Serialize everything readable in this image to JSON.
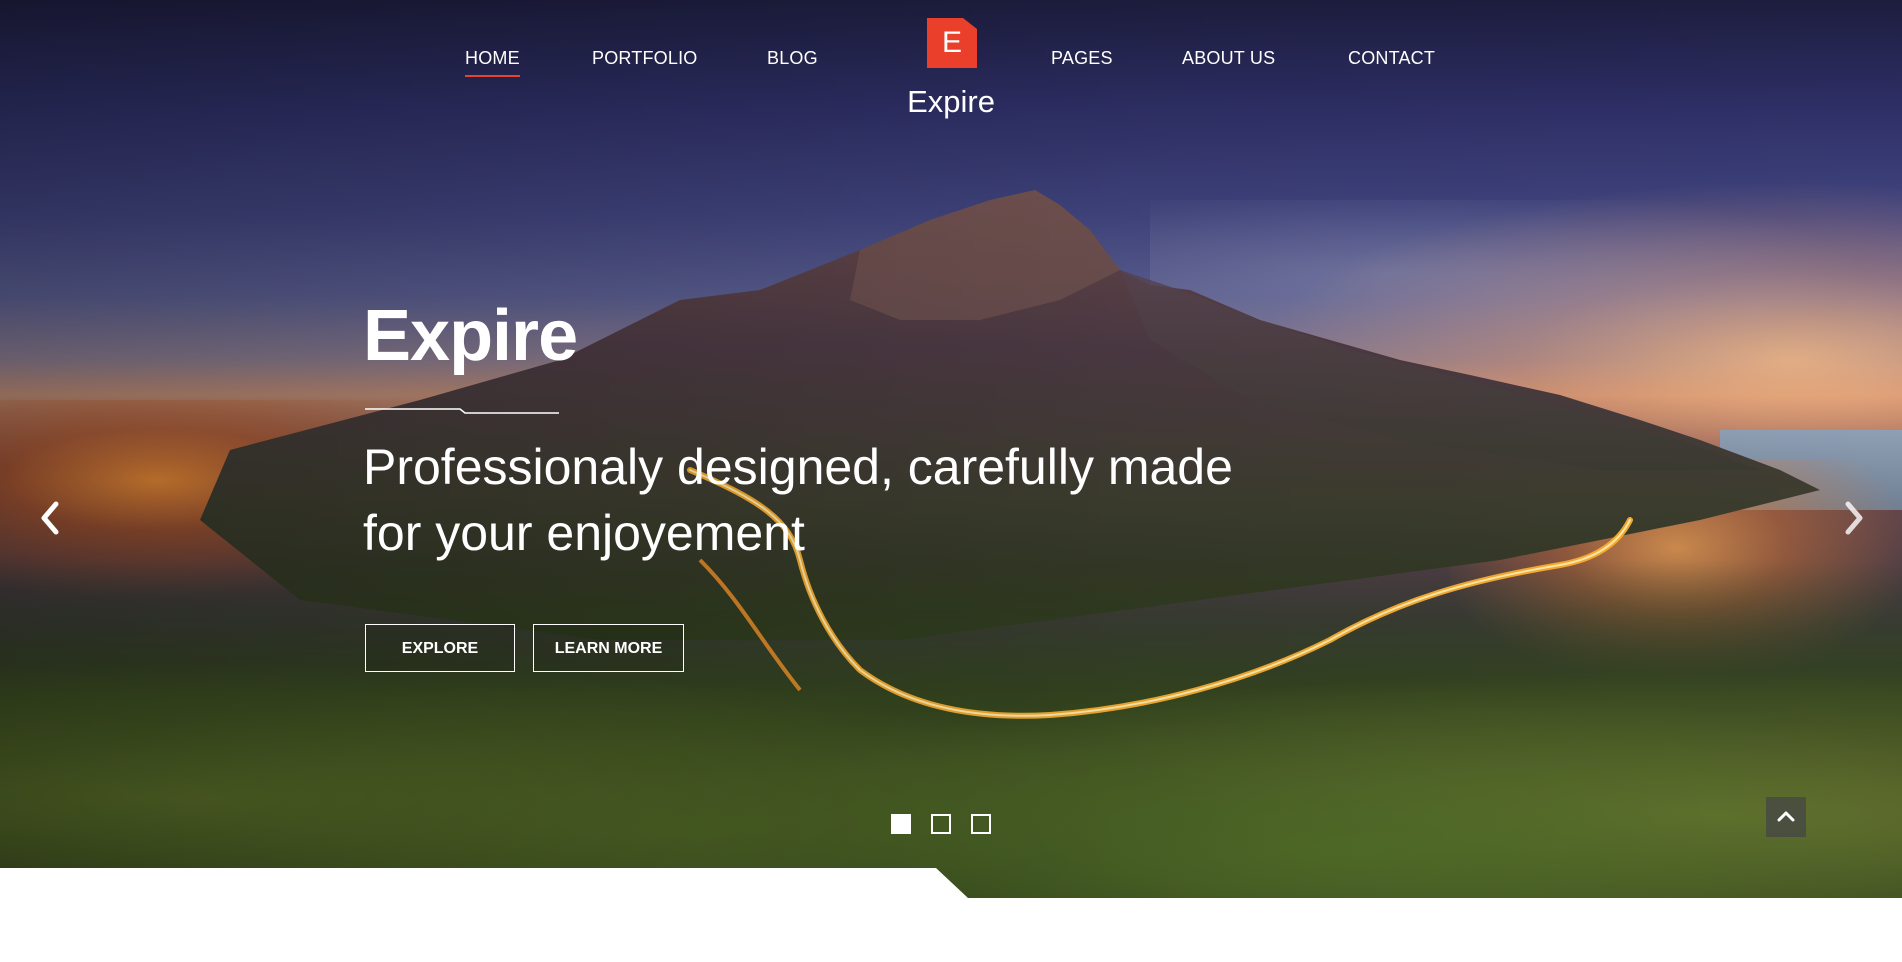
{
  "nav": {
    "items": [
      {
        "label": "HOME",
        "active": true
      },
      {
        "label": "PORTFOLIO",
        "active": false
      },
      {
        "label": "BLOG",
        "active": false
      },
      {
        "label": "PAGES",
        "active": false
      },
      {
        "label": "ABOUT US",
        "active": false
      },
      {
        "label": "CONTACT",
        "active": false
      }
    ]
  },
  "logo": {
    "letter": "E",
    "name": "Expire"
  },
  "hero": {
    "title": "Expire",
    "subtitle_line1": "Professionaly designed, carefully made",
    "subtitle_line2": "for your enjoyement",
    "buttons": {
      "explore": "EXPLORE",
      "learn_more": "LEARN MORE"
    }
  },
  "slider": {
    "slide_count": 3,
    "active_slide": 1
  },
  "icons": {
    "prev": "chevron-left-icon",
    "next": "chevron-right-icon",
    "back_to_top": "chevron-up-icon"
  },
  "colors": {
    "accent": "#ea3f2a",
    "text": "#ffffff",
    "page_background": "#ffffff"
  }
}
